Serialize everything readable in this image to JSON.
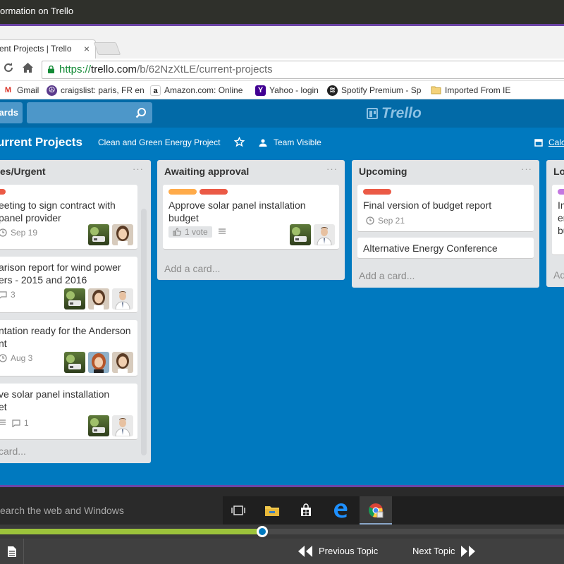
{
  "player": {
    "title": "ormation on Trello",
    "prev_label": "Previous Topic",
    "next_label": "Next Topic",
    "progress": 0.465
  },
  "browser": {
    "tab_title": "ent Projects | Trello",
    "tab_close": "×",
    "url_scheme": "https://",
    "url_host": "trello.com",
    "url_path": "/b/62NzXtLE/current-projects",
    "bookmarks": [
      {
        "label": "Gmail",
        "icon": "gmail-icon"
      },
      {
        "label": "craigslist: paris, FR en",
        "icon": "peace-icon"
      },
      {
        "label": "Amazon.com: Online",
        "icon": "amazon-icon"
      },
      {
        "label": "Yahoo - login",
        "icon": "yahoo-icon"
      },
      {
        "label": "Spotify Premium - Sp",
        "icon": "spotify-icon"
      },
      {
        "label": "Imported From IE",
        "icon": "folder-icon"
      }
    ]
  },
  "trello": {
    "boards_label": "ards",
    "logo_text": "Trello",
    "board_title": "urrent Projects",
    "board_org": "Clean and Green Energy Project",
    "board_visibility": "Team Visible",
    "calendar_label": "Calc",
    "lists": [
      {
        "name": "es/Urgent",
        "cards": [
          {
            "title_lines": [
              "eeting to sign contract with",
              "panel provider"
            ],
            "labels": [
              "#eb5a46"
            ],
            "due": "Sep 19",
            "members": [
              "landscape",
              "woman"
            ]
          },
          {
            "title_lines": [
              "arison report for wind power",
              "ers - 2015 and 2016"
            ],
            "comments": "3",
            "members": [
              "landscape",
              "woman",
              "man"
            ]
          },
          {
            "title_lines": [
              "ntation ready for the Anderson",
              "nt"
            ],
            "due": "Aug 3",
            "members": [
              "landscape",
              "redhead",
              "woman"
            ]
          },
          {
            "title_lines": [
              "ve solar panel installation",
              "et"
            ],
            "comments": "1",
            "members": [
              "landscape",
              "man"
            ]
          }
        ],
        "add_card": "card..."
      },
      {
        "name": "Awaiting approval",
        "cards": [
          {
            "title_lines": [
              "Approve solar panel installation",
              "budget"
            ],
            "labels": [
              "#ffab4a",
              "#eb5a46"
            ],
            "votes": "1 vote",
            "members": [
              "landscape",
              "man"
            ]
          }
        ],
        "add_card": "Add a card..."
      },
      {
        "name": "Upcoming",
        "cards": [
          {
            "title_lines": [
              "Final version of budget report"
            ],
            "labels": [
              "#eb5a46"
            ],
            "due": "Sep 21"
          },
          {
            "title_lines": [
              "Alternative Energy Conference"
            ]
          }
        ],
        "add_card": "Add a card..."
      },
      {
        "name": "Lo",
        "cards": [
          {
            "title_lines": [
              "In",
              "er",
              "bu"
            ],
            "labels": [
              "#c377e0"
            ]
          }
        ],
        "add_card": "Ad"
      }
    ]
  },
  "taskbar": {
    "search_placeholder": "earch the web and Windows"
  }
}
